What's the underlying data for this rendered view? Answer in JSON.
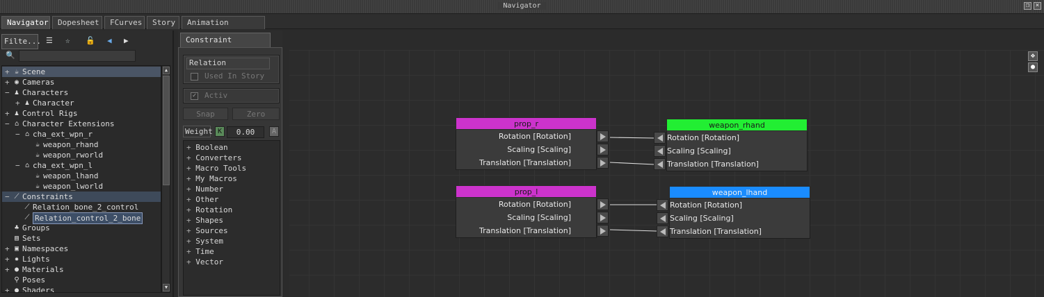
{
  "window": {
    "title": "Navigator"
  },
  "tabs": [
    "Navigator",
    "Dopesheet",
    "FCurves",
    "Story",
    "Animation Trigger"
  ],
  "left": {
    "filter_label": "Filte...",
    "search_placeholder": "",
    "tree": [
      {
        "label": "Scene",
        "indent": 0,
        "expander": "+",
        "icon": "teapot-icon",
        "selected": "scene"
      },
      {
        "label": "Cameras",
        "indent": 0,
        "expander": "+",
        "icon": "camera-icon"
      },
      {
        "label": "Characters",
        "indent": 0,
        "expander": "−",
        "icon": "character-icon"
      },
      {
        "label": "Character",
        "indent": 1,
        "expander": "+",
        "icon": "character-icon"
      },
      {
        "label": "Control Rigs",
        "indent": 0,
        "expander": "+",
        "icon": "rig-icon"
      },
      {
        "label": "Character Extensions",
        "indent": 0,
        "expander": "−",
        "icon": "extension-icon"
      },
      {
        "label": "cha_ext_wpn_r",
        "indent": 1,
        "expander": "−",
        "icon": "extension-icon"
      },
      {
        "label": "weapon_rhand",
        "indent": 2,
        "expander": "",
        "icon": "teapot-icon"
      },
      {
        "label": "weapon_rworld",
        "indent": 2,
        "expander": "",
        "icon": "teapot-icon"
      },
      {
        "label": "cha_ext_wpn_l",
        "indent": 1,
        "expander": "−",
        "icon": "extension-icon"
      },
      {
        "label": "weapon_lhand",
        "indent": 2,
        "expander": "",
        "icon": "teapot-icon"
      },
      {
        "label": "weapon_lworld",
        "indent": 2,
        "expander": "",
        "icon": "teapot-icon"
      },
      {
        "label": "Constraints",
        "indent": 0,
        "expander": "−",
        "icon": "constraint-icon",
        "selected": "cons"
      },
      {
        "label": "Relation_bone_2_control",
        "indent": 1,
        "expander": "",
        "icon": "constraint-icon"
      },
      {
        "label": "Relation_control_2_bone",
        "indent": 1,
        "expander": "",
        "icon": "constraint-icon",
        "selected": "item"
      },
      {
        "label": "Groups",
        "indent": 0,
        "expander": "",
        "icon": "groups-icon"
      },
      {
        "label": "Sets",
        "indent": 0,
        "expander": "",
        "icon": "sets-icon"
      },
      {
        "label": "Namespaces",
        "indent": 0,
        "expander": "+",
        "icon": "namespace-icon"
      },
      {
        "label": "Lights",
        "indent": 0,
        "expander": "+",
        "icon": "light-icon"
      },
      {
        "label": "Materials",
        "indent": 0,
        "expander": "+",
        "icon": "material-icon"
      },
      {
        "label": "Poses",
        "indent": 0,
        "expander": "",
        "icon": "pose-icon"
      },
      {
        "label": "Shaders",
        "indent": 0,
        "expander": "+",
        "icon": "shader-icon"
      }
    ]
  },
  "constraint_settings": {
    "tab_label": "Constraint Settings",
    "type_label": "Relation",
    "used_in_story": "Used In Story",
    "active": "Activ",
    "snap": "Snap",
    "zero": "Zero",
    "weight_label": "Weight",
    "weight_key": "K",
    "weight_value": "0.00",
    "weight_anim": "A",
    "library": [
      "Boolean",
      "Converters",
      "Macro Tools",
      "My Macros",
      "Number",
      "Other",
      "Rotation",
      "Shapes",
      "Sources",
      "System",
      "Time",
      "Vector"
    ]
  },
  "graph": {
    "source_color": "#cc33cc",
    "rhand_color": "#22ee33",
    "lhand_color": "#1a8cff",
    "nodes": [
      {
        "id": "prop_r",
        "title": "prop_r",
        "kind": "src",
        "rows": [
          "Rotation [Rotation]",
          "Scaling [Scaling]",
          "Translation [Translation]"
        ]
      },
      {
        "id": "weapon_rhand",
        "title": "weapon_rhand",
        "kind": "dst",
        "rows": [
          "Rotation [Rotation]",
          "Scaling [Scaling]",
          "Translation [Translation]"
        ]
      },
      {
        "id": "prop_l",
        "title": "prop_l",
        "kind": "src",
        "rows": [
          "Rotation [Rotation]",
          "Scaling [Scaling]",
          "Translation [Translation]"
        ]
      },
      {
        "id": "weapon_lhand",
        "title": "weapon_lhand",
        "kind": "dst",
        "rows": [
          "Rotation [Rotation]",
          "Scaling [Scaling]",
          "Translation [Translation]"
        ]
      }
    ]
  }
}
